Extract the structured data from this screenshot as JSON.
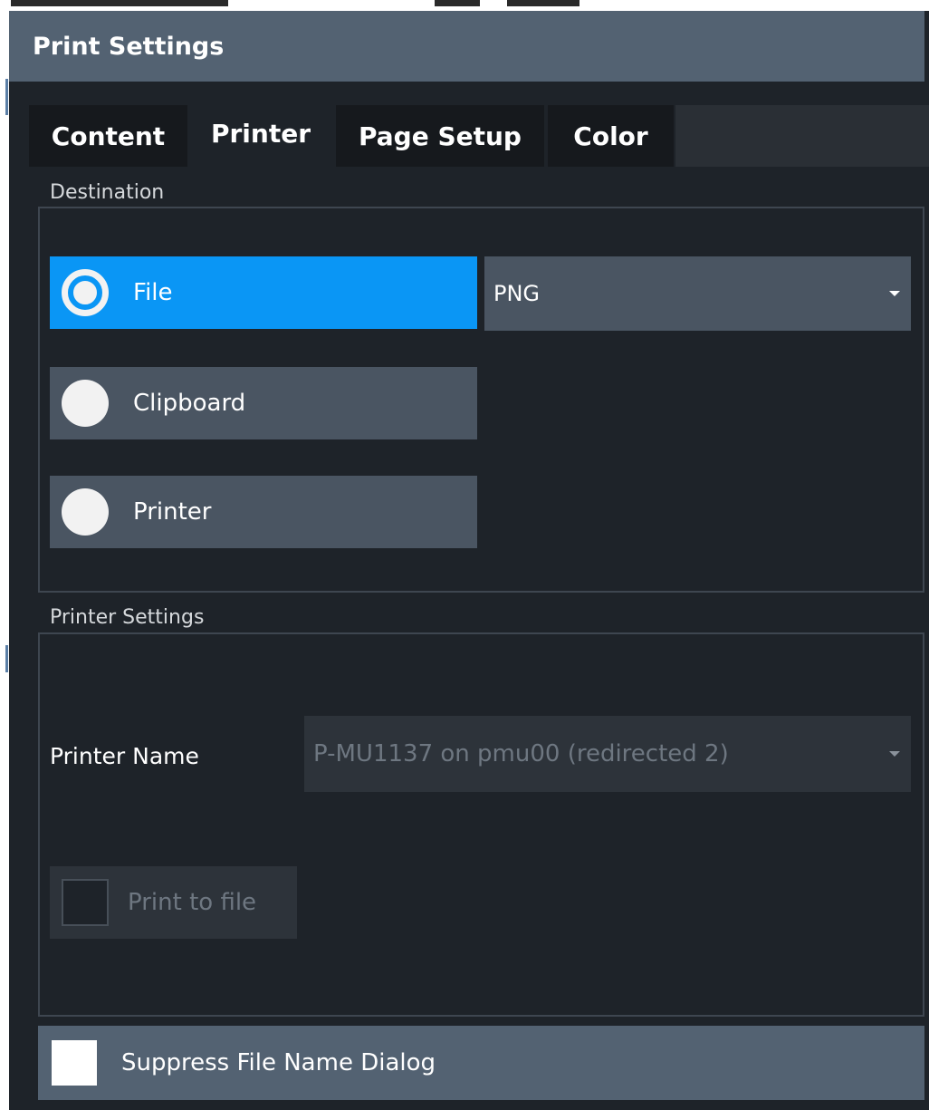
{
  "dialog": {
    "title": "Print Settings"
  },
  "tabs": [
    {
      "label": "Content",
      "active": false
    },
    {
      "label": "Printer",
      "active": true
    },
    {
      "label": "Page Setup",
      "active": false
    },
    {
      "label": "Color",
      "active": false
    }
  ],
  "destination": {
    "label": "Destination",
    "options": [
      {
        "label": "File",
        "selected": true
      },
      {
        "label": "Clipboard",
        "selected": false
      },
      {
        "label": "Printer",
        "selected": false
      }
    ],
    "format": {
      "value": "PNG"
    }
  },
  "printer_settings": {
    "label": "Printer Settings",
    "printer_name": {
      "label": "Printer Name",
      "value": "P-MU1137 on pmu00 (redirected 2)",
      "enabled": false
    },
    "print_to_file": {
      "label": "Print to file",
      "checked": false,
      "enabled": false
    }
  },
  "suppress_file_name_dialog": {
    "label": "Suppress File Name Dialog",
    "checked": false
  },
  "colors": {
    "accent": "#0a96f5",
    "title_bar": "#536272",
    "background": "#1e2329",
    "control": "#4a5562"
  }
}
